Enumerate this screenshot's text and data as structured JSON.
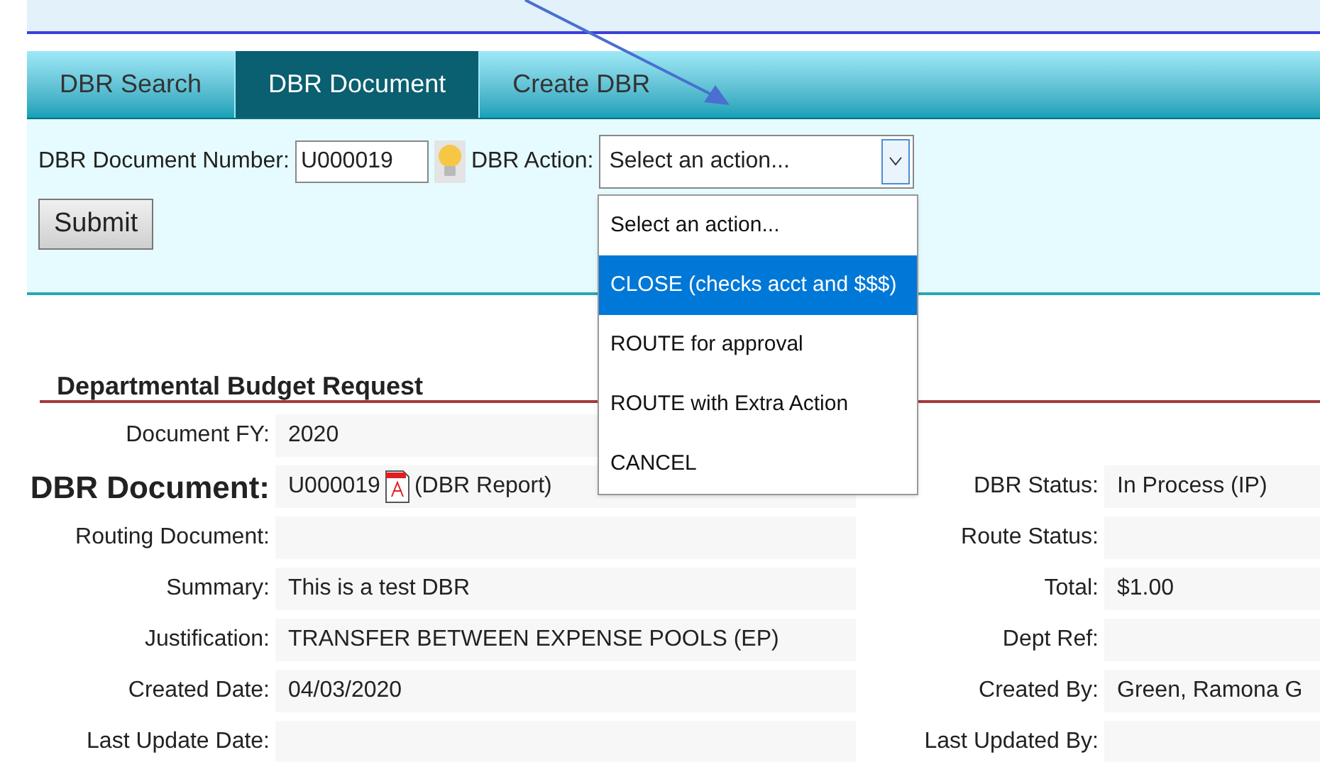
{
  "tabs": [
    {
      "label": "DBR Search",
      "selected": false
    },
    {
      "label": "DBR Document",
      "selected": true
    },
    {
      "label": "Create DBR",
      "selected": false
    }
  ],
  "form": {
    "number_label": "DBR Document Number:",
    "number_value": "U000019",
    "action_label": "DBR Action:",
    "action_value": "Select an action...",
    "submit": "Submit",
    "options": [
      {
        "label": "Select an action...",
        "selected": false
      },
      {
        "label": "CLOSE (checks acct and $$$)",
        "selected": true
      },
      {
        "label": "ROUTE for approval",
        "selected": false
      },
      {
        "label": "ROUTE with Extra Action",
        "selected": false
      },
      {
        "label": "CANCEL",
        "selected": false
      }
    ]
  },
  "section": {
    "title": "Departmental Budget Request",
    "rows": [
      {
        "kind": "field",
        "label": "Document FY:",
        "value": "2020"
      },
      {
        "kind": "heading",
        "label": "DBR Document:",
        "value": "U000019",
        "report": "(DBR Report)",
        "right_label": "DBR Status:",
        "right_value": "In Process (IP)"
      },
      {
        "kind": "field",
        "label": "Routing Document:",
        "value": "",
        "right_label": "Route Status:",
        "right_value": ""
      },
      {
        "kind": "field",
        "label": "Summary:",
        "value": "This is a test DBR",
        "right_label": "Total:",
        "right_value": "$1.00"
      },
      {
        "kind": "field",
        "label": "Justification:",
        "value": "TRANSFER BETWEEN EXPENSE POOLS (EP)",
        "right_label": "Dept Ref:",
        "right_value": ""
      },
      {
        "kind": "field",
        "label": "Created Date:",
        "value": "04/03/2020",
        "right_label": "Created By:",
        "right_value": "Green, Ramona G"
      },
      {
        "kind": "field",
        "label": "Last Update Date:",
        "value": "",
        "right_label": "Last Updated By:",
        "right_value": ""
      }
    ]
  }
}
